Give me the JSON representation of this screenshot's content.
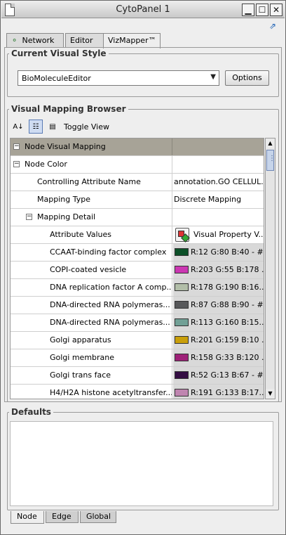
{
  "window": {
    "title": "CytoPanel 1",
    "minimize_label": "▁",
    "maximize_label": "☐",
    "close_label": "✕"
  },
  "tabs": [
    {
      "label": "Network",
      "icon": "network-icon"
    },
    {
      "label": "Editor"
    },
    {
      "label": "VizMapper™"
    }
  ],
  "current_style": {
    "section_title": "Current Visual Style",
    "selected": "BioMoleculeEditor",
    "options_label": "Options"
  },
  "browser": {
    "section_title": "Visual Mapping Browser",
    "toggle_label": "Toggle View",
    "rows": {
      "header": {
        "c1": "Node Visual Mapping",
        "c2": ""
      },
      "node_color": {
        "c1": "Node Color",
        "c2": ""
      },
      "controlling_attr": {
        "c1": "Controlling Attribute Name",
        "c2": "annotation.GO CELLUL..."
      },
      "mapping_type": {
        "c1": "Mapping Type",
        "c2": "Discrete Mapping"
      },
      "mapping_detail": {
        "c1": "Mapping Detail",
        "c2": ""
      },
      "attribute_values": {
        "c1": "Attribute Values",
        "c2": "Visual Property V..."
      }
    },
    "color_rows": [
      {
        "name": "CCAAT-binding factor complex",
        "value": "R:12 G:80 B:40 - #...",
        "color": "#0c5028"
      },
      {
        "name": "COPI-coated vesicle",
        "value": "R:203 G:55 B:178 ...",
        "color": "#cb37b2"
      },
      {
        "name": "DNA replication factor A comp...",
        "value": "R:178 G:190 B:16...",
        "color": "#b2bea8"
      },
      {
        "name": "DNA-directed RNA polymeras...",
        "value": "R:87 G:88 B:90 - #...",
        "color": "#57585a"
      },
      {
        "name": "DNA-directed RNA polymeras...",
        "value": "R:113 G:160 B:15...",
        "color": "#71a096"
      },
      {
        "name": "Golgi apparatus",
        "value": "R:201 G:159 B:10 ...",
        "color": "#c99f0a"
      },
      {
        "name": "Golgi membrane",
        "value": "R:158 G:33 B:120 ...",
        "color": "#9e2178"
      },
      {
        "name": "Golgi trans face",
        "value": "R:52 G:13 B:67 - #...",
        "color": "#340d43"
      },
      {
        "name": "H4/H2A histone acetyltransfer...",
        "value": "R:191 G:133 B:17...",
        "color": "#bf85b0"
      }
    ]
  },
  "defaults": {
    "section_title": "Defaults"
  },
  "bottom_tabs": [
    "Node",
    "Edge",
    "Global"
  ]
}
